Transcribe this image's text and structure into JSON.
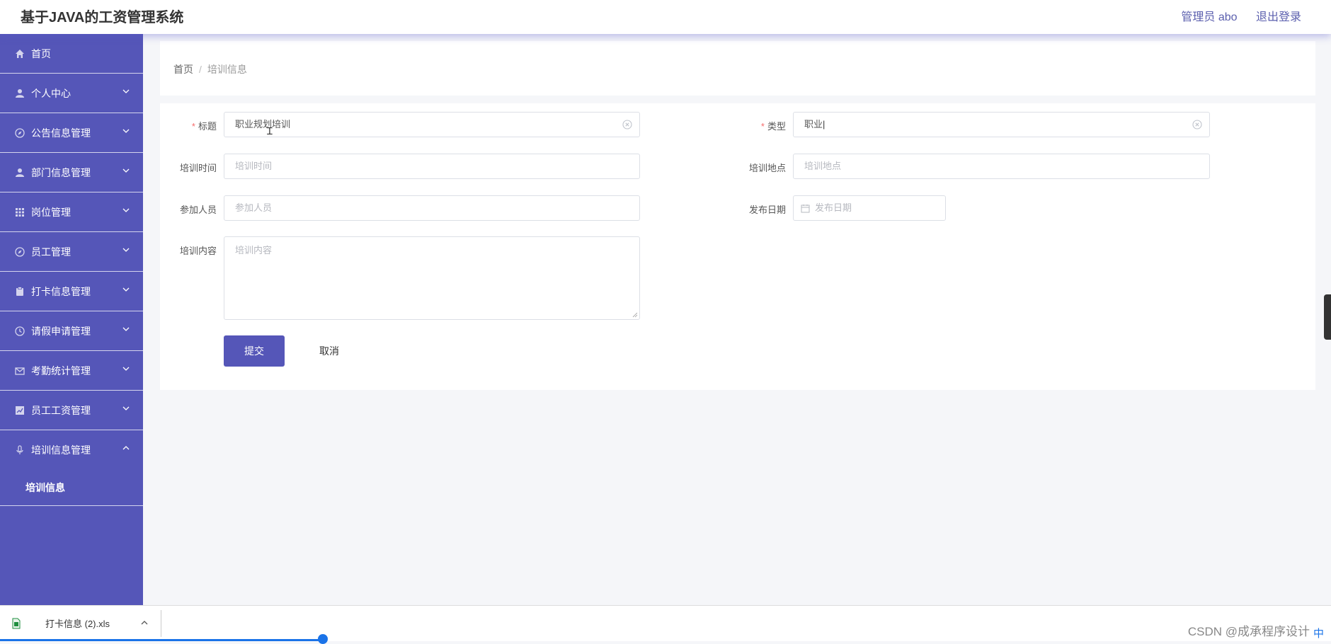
{
  "header": {
    "title": "基于JAVA的工资管理系统",
    "user": "管理员 abo",
    "logout": "退出登录"
  },
  "sidebar": {
    "items": [
      {
        "label": "首页",
        "icon": "home-icon",
        "expandable": false
      },
      {
        "label": "个人中心",
        "icon": "user-icon",
        "expandable": true
      },
      {
        "label": "公告信息管理",
        "icon": "compass-icon",
        "expandable": true
      },
      {
        "label": "部门信息管理",
        "icon": "user-icon",
        "expandable": true
      },
      {
        "label": "岗位管理",
        "icon": "grid-icon",
        "expandable": true
      },
      {
        "label": "员工管理",
        "icon": "compass-icon",
        "expandable": true
      },
      {
        "label": "打卡信息管理",
        "icon": "clipboard-icon",
        "expandable": true
      },
      {
        "label": "请假申请管理",
        "icon": "clock-icon",
        "expandable": true
      },
      {
        "label": "考勤统计管理",
        "icon": "mail-icon",
        "expandable": true
      },
      {
        "label": "员工工资管理",
        "icon": "chart-icon",
        "expandable": true
      },
      {
        "label": "培训信息管理",
        "icon": "mic-icon",
        "expandable": true,
        "expanded": true
      }
    ],
    "sub_item": "培训信息"
  },
  "breadcrumb": {
    "home": "首页",
    "sep": "/",
    "current": "培训信息"
  },
  "form": {
    "title_label": "标题",
    "title_value": "职业规划培训",
    "type_label": "类型",
    "type_value": "职业",
    "time_label": "培训时间",
    "time_placeholder": "培训时间",
    "place_label": "培训地点",
    "place_placeholder": "培训地点",
    "people_label": "参加人员",
    "people_placeholder": "参加人员",
    "date_label": "发布日期",
    "date_placeholder": "发布日期",
    "content_label": "培训内容",
    "content_placeholder": "培训内容",
    "required_mark": "*",
    "submit": "提交",
    "cancel": "取消"
  },
  "download_bar": {
    "file_name": "打卡信息 (2).xls",
    "watermark": "CSDN @成承程序设计",
    "ime": "中"
  },
  "colors": {
    "sidebar": "#5556b8",
    "accent": "#5556b8",
    "required": "#f56c6c"
  }
}
